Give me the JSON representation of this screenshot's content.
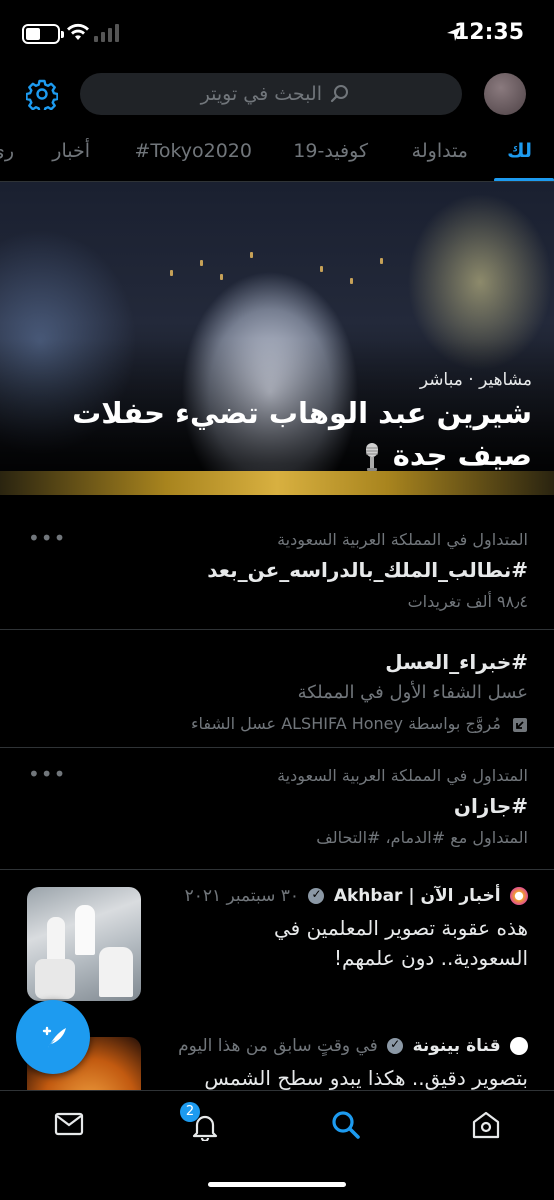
{
  "status_bar": {
    "time": "12:35"
  },
  "header": {
    "search_placeholder": "البحث في تويتر"
  },
  "tabs": [
    "لك",
    "متداولة",
    "كوفيد-19",
    "#Tokyo2020",
    "أخبار",
    "ري"
  ],
  "hero": {
    "category": "مشاهير · مباشر",
    "title_line1": "شيرين عبد الوهاب تضيء حفلات",
    "title_line2": "صيف جدة"
  },
  "trends": [
    {
      "context": "المتداول في المملكة العربية السعودية",
      "name": "#نطالب_الملك_بالدراسه_عن_بعد",
      "count": "٩٨٫٤ ألف تغريدات"
    },
    {
      "name": "#خبراء_العسل",
      "description": "عسل الشفاء الأول في المملكة",
      "promoted": "مُروَّج بواسطة ALSHIFA Honey عسل الشفاء"
    },
    {
      "context": "المتداول في المملكة العربية السعودية",
      "name": "#جازان",
      "related": "المتداول مع #الدمام، #التحالف"
    }
  ],
  "news": [
    {
      "source": "أخبار الآن | Akhbar",
      "date": "٣٠ سبتمبر ٢٠٢١",
      "title_line1": "هذه عقوبة تصوير المعلمين في",
      "title_line2": "السعودية.. دون علمهم!"
    },
    {
      "source": "قناة بينونة",
      "date": "في وقتٍ سابق من هذا اليوم",
      "title_line1": "بتصوير دقيق.. هكذا يبدو سطح الشمس"
    }
  ],
  "bottom_nav": {
    "notifications_badge": "2"
  },
  "colors": {
    "accent": "#1d9bf0",
    "background": "#000000",
    "secondary_text": "#71767b"
  }
}
